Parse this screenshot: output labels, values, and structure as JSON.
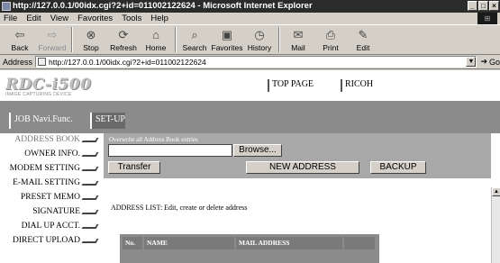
{
  "window": {
    "title": "http://127.0.0.1/00idx.cgi?2+id=011002122624 - Microsoft Internet Explorer",
    "buttons": [
      "_",
      "□",
      "×"
    ]
  },
  "menu": [
    "File",
    "Edit",
    "View",
    "Favorites",
    "Tools",
    "Help"
  ],
  "toolbar": {
    "buttons": [
      {
        "label": "Back",
        "icon": "back-arrow",
        "enabled": true
      },
      {
        "label": "Forward",
        "icon": "forward-arrow",
        "enabled": false
      },
      {
        "label": "Stop",
        "icon": "stop-icon",
        "enabled": true
      },
      {
        "label": "Refresh",
        "icon": "refresh-icon",
        "enabled": true
      },
      {
        "label": "Home",
        "icon": "home-icon",
        "enabled": true
      },
      {
        "label": "Search",
        "icon": "search-icon",
        "enabled": true
      },
      {
        "label": "Favorites",
        "icon": "favorites-icon",
        "enabled": true
      },
      {
        "label": "History",
        "icon": "history-icon",
        "enabled": true
      },
      {
        "label": "Mail",
        "icon": "mail-icon",
        "enabled": true
      },
      {
        "label": "Print",
        "icon": "print-icon",
        "enabled": true
      },
      {
        "label": "Edit",
        "icon": "edit-icon",
        "enabled": true
      }
    ]
  },
  "address": {
    "label": "Address",
    "url": "http://127.0.0.1/00idx.cgi?2+id=011002122624",
    "go_label": "Go"
  },
  "header": {
    "logo": "RDC-i500",
    "logo_sub": "IMAGE CAPTURING DEVICE",
    "links": [
      "TOP PAGE",
      "RICOH"
    ]
  },
  "nav": {
    "tabs": [
      "JOB Navi.Func.",
      "SET-UP"
    ],
    "selected": "SET-UP"
  },
  "sidebar": {
    "items": [
      "ADDRESS BOOK",
      "OWNER INFO.",
      "MODEM SETTING",
      "E-MAIL SETTING",
      "PRESET MEMO",
      "SIGNATURE",
      "DIAL UP ACCT.",
      "DIRECT UPLOAD"
    ]
  },
  "main": {
    "overwrite_label": "Overwrite all Address Book entries",
    "file_value": "",
    "browse_label": "Browse...",
    "transfer_label": "Transfer",
    "new_address_label": "NEW ADDRESS",
    "backup_label": "BACKUP",
    "address_list_label": "ADDRESS LIST: Edit, create or delete address",
    "table_headers": [
      "No.",
      "NAME",
      "MAIL ADDRESS",
      ""
    ]
  },
  "colors": {
    "nav_bar": "#8b8b8b",
    "title_bar": "#2b2b2b",
    "form_band": "#a8a8a8"
  }
}
